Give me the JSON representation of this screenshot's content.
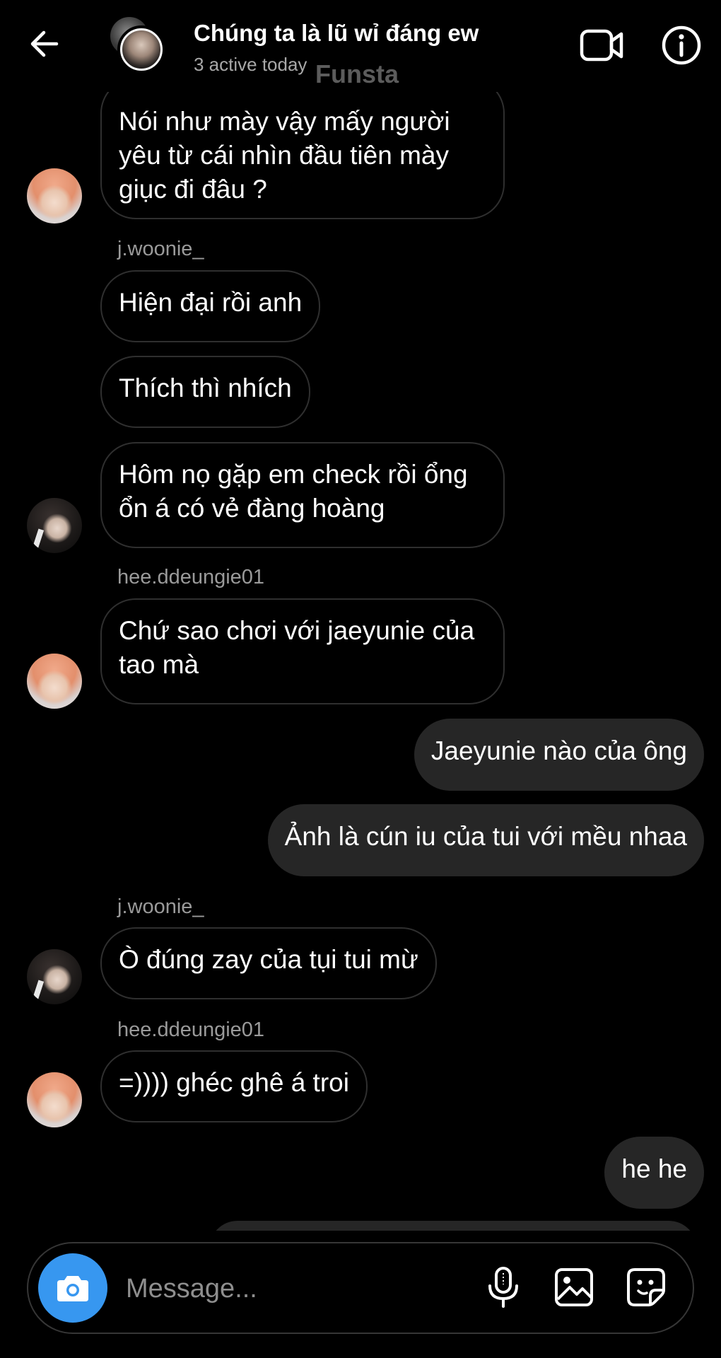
{
  "header": {
    "title": "Chúng ta là lũ wỉ đáng ew",
    "subtitle": "3 active today",
    "watermark": "Funsta"
  },
  "messages": [
    {
      "direction": "in",
      "text": "Nói như mày vậy mấy người yêu từ cái nhìn đầu tiên mày giục đi đâu ?",
      "avatar": "blond"
    },
    {
      "sender": "j.woonie_"
    },
    {
      "direction": "in",
      "text": "Hiện đại rồi anh"
    },
    {
      "direction": "in",
      "text": "Thích thì nhích"
    },
    {
      "direction": "in",
      "text": "Hôm nọ gặp em check rồi ổng ổn á có vẻ đàng hoàng",
      "avatar": "dark"
    },
    {
      "sender": "hee.ddeungie01"
    },
    {
      "direction": "in",
      "text": "Chứ sao chơi với jaeyunie của tao mà",
      "avatar": "blond"
    },
    {
      "direction": "out",
      "text": "Jaeyunie nào của ông"
    },
    {
      "direction": "out",
      "text": "Ảnh là cún iu của tui với mều nhaa"
    },
    {
      "sender": "j.woonie_"
    },
    {
      "direction": "in",
      "text": "Ò đúng zay của tụi tui mừ",
      "avatar": "dark"
    },
    {
      "sender": "hee.ddeungie01"
    },
    {
      "direction": "in",
      "text": "=)))) ghéc ghê á troi",
      "avatar": "blond"
    },
    {
      "direction": "out",
      "text": "he he"
    }
  ],
  "composer": {
    "placeholder": "Message..."
  },
  "icons": {
    "back": "arrow-left-icon",
    "video": "video-camera-icon",
    "info": "info-icon",
    "camera": "camera-icon",
    "mic": "microphone-icon",
    "gallery": "image-icon",
    "sticker": "sticker-icon"
  },
  "colors": {
    "background": "#000000",
    "incoming_border": "#2f2f2f",
    "outgoing_bubble": "#262626",
    "camera_button": "#3797f0",
    "secondary_text": "#a8a8a8"
  }
}
